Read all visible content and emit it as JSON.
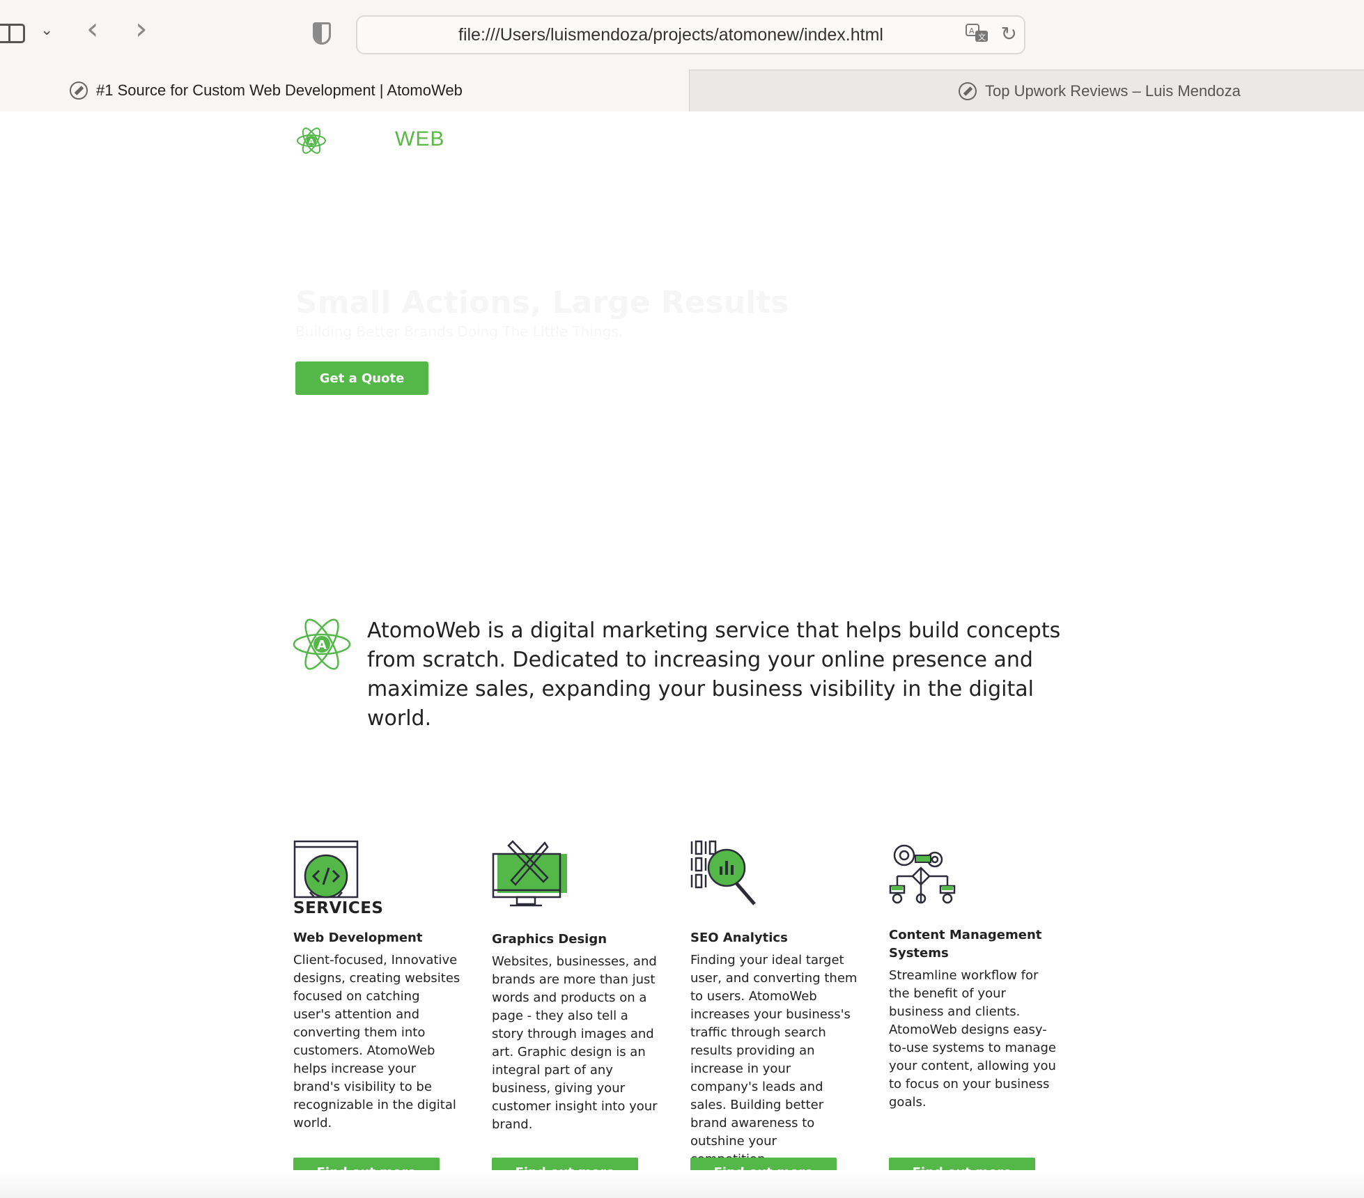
{
  "browser": {
    "url": "file:///Users/luismendoza/projects/atomonew/index.html",
    "tabs": [
      {
        "label": "#1 Source for Custom Web Development | AtomoWeb",
        "active": true
      },
      {
        "label": "Top Upwork Reviews – Luis Mendoza",
        "active": false
      }
    ]
  },
  "page": {
    "brand_color": "#53b848",
    "logo_text": "WEB",
    "hero": {
      "title": "Small Actions, Large Results",
      "subtitle": "Building Better Brands Doing The Little Things.",
      "cta_label": "Get a Quote"
    },
    "about": {
      "text": "AtomoWeb is a digital marketing service that helps build concepts from scratch. Dedicated to increasing your online presence and maximize sales, expanding your business visibility in the digital world."
    },
    "services": {
      "heading": "SERVICES",
      "items": [
        {
          "icon": "web-development-icon",
          "title": "Web Development",
          "description": "Client-focused, Innovative designs, creating websites focused on catching user's attention and converting them into customers. AtomoWeb helps increase your brand's visibility to be recognizable in the digital world.",
          "button": "Find out more"
        },
        {
          "icon": "graphics-design-icon",
          "title": "Graphics Design",
          "description": "Websites, businesses, and brands are more than just words and products on a page - they also tell a story through images and art. Graphic design is an integral part of any business, giving your customer insight into your brand.",
          "button": "Find out more"
        },
        {
          "icon": "seo-analytics-icon",
          "title": "SEO Analytics",
          "description": "Finding your ideal target user, and converting them to users. AtomoWeb increases your business's traffic through search results providing an increase in your company's leads and sales. Building better brand awareness to outshine your competition.",
          "button": "Find out more"
        },
        {
          "icon": "cms-icon",
          "title": "Content Management Systems",
          "description": "Streamline workflow for the benefit of your business and clients. AtomoWeb designs easy-to-use systems to manage your content, allowing you to focus on your business goals.",
          "button": "Find out more"
        }
      ]
    }
  }
}
